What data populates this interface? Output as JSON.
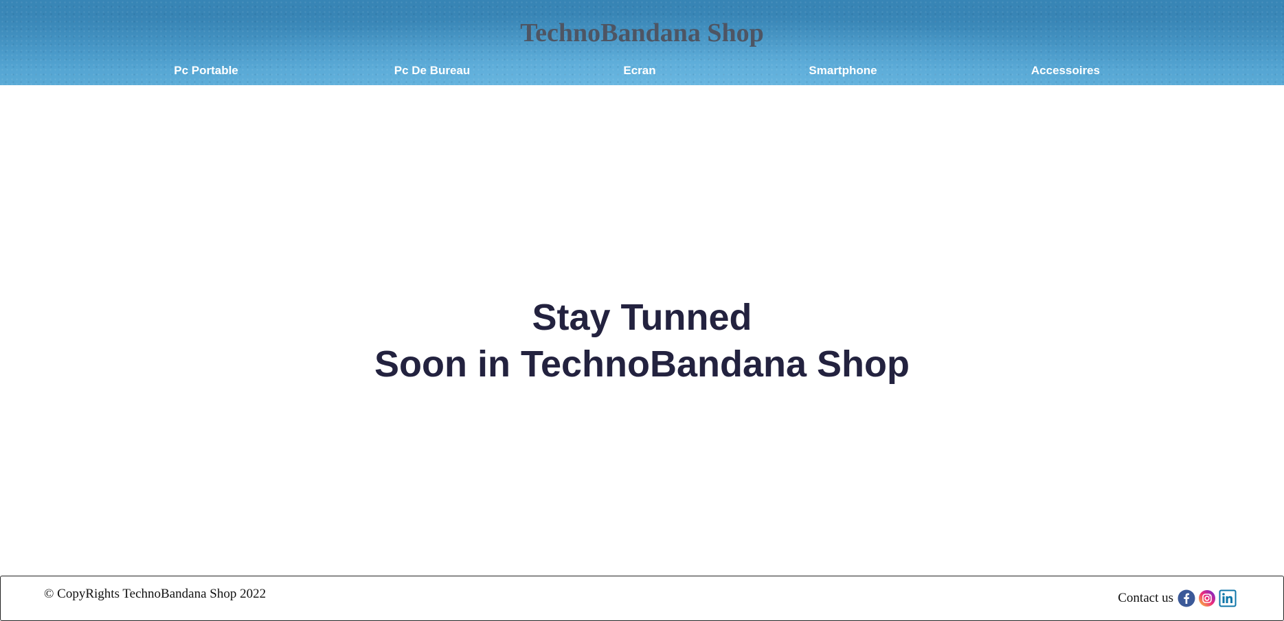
{
  "header": {
    "title": "TechnoBandana Shop",
    "nav": [
      {
        "label": "Pc Portable",
        "name": "nav-pc-portable"
      },
      {
        "label": "Pc De Bureau",
        "name": "nav-pc-de-bureau"
      },
      {
        "label": "Ecran",
        "name": "nav-ecran"
      },
      {
        "label": "Smartphone",
        "name": "nav-smartphone"
      },
      {
        "label": "Accessoires",
        "name": "nav-accessoires"
      }
    ]
  },
  "main": {
    "line1": "Stay Tunned",
    "line2": "Soon in TechnoBandana Shop"
  },
  "footer": {
    "copyright": "© CopyRights TechnoBandana Shop 2022",
    "contact_label": "Contact us",
    "social": [
      {
        "icon": "facebook-icon",
        "color": "#3b5998"
      },
      {
        "icon": "instagram-icon",
        "color": "#e1306c"
      },
      {
        "icon": "linkedin-icon",
        "color": "#0e76a8"
      }
    ]
  },
  "colors": {
    "header_blue": "#4fa0cf",
    "title_gray": "#4e5563",
    "headline_navy": "#23223f"
  }
}
